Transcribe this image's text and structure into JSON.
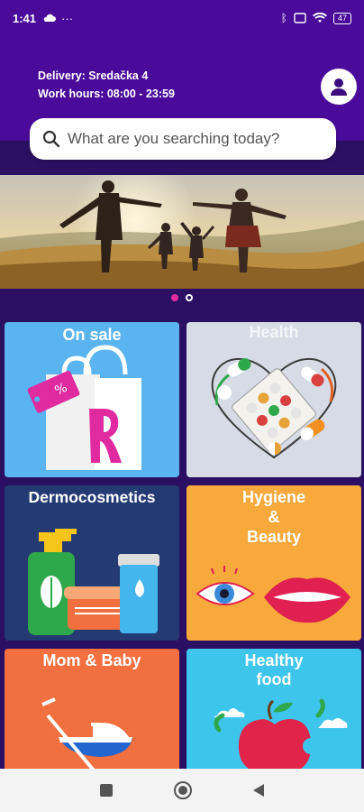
{
  "status_bar": {
    "time": "1:41",
    "battery": "47"
  },
  "header": {
    "delivery": "Delivery: Sredačka 4",
    "work_hours": "Work hours: 08:00 - 23:59"
  },
  "search": {
    "placeholder": "What are you searching today?"
  },
  "banner": {
    "slides": 2,
    "active_slide": 1
  },
  "categories": [
    {
      "title": "On sale",
      "color": "#5ab4f0"
    },
    {
      "title": "Health",
      "color": "#d6dbe6"
    },
    {
      "title": "Dermocosmetics",
      "color": "#243a73"
    },
    {
      "title_lines": [
        "Hygiene",
        "&",
        "Beauty"
      ],
      "color": "#f7a93c"
    },
    {
      "title": "Mom & Baby",
      "color": "#f26f3f"
    },
    {
      "title_lines": [
        "Healthy",
        "food"
      ],
      "color": "#3ec5ec"
    }
  ],
  "colors": {
    "brand": "#4a0a9a",
    "accent": "#e02ba0"
  }
}
